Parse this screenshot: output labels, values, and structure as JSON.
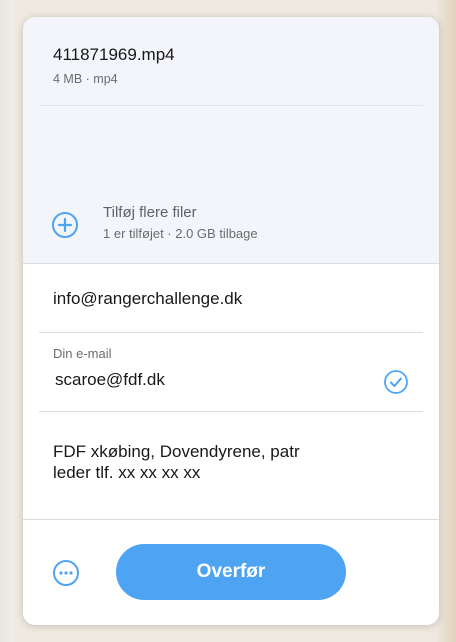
{
  "colors": {
    "accent": "#4ea4f2",
    "button_text": "#ffffff",
    "text_primary": "#17181a",
    "text_secondary": "#6a6d70",
    "panel_background": "#ffffff",
    "files_area_background": "#f4f5fa"
  },
  "files": [
    {
      "name": "411871969.mp4",
      "meta": "4 MB · mp4"
    }
  ],
  "add_more": {
    "icon": "plus-circle-icon",
    "label": "Tilføj flere filer",
    "summary": "1 er tilføjet · 2.0 GB tilbage"
  },
  "form": {
    "to": {
      "value": "info@rangerchallenge.dk"
    },
    "from": {
      "label": "Din e-mail",
      "value": "scaroe@fdf.dk",
      "status_icon": "check-circle-icon"
    },
    "message": {
      "value": "FDF xkøbing, Dovendyrene, patr\nleder tlf. xx xx xx xx"
    }
  },
  "footer": {
    "more_icon": "more-options-icon",
    "transfer_label": "Overfør"
  }
}
